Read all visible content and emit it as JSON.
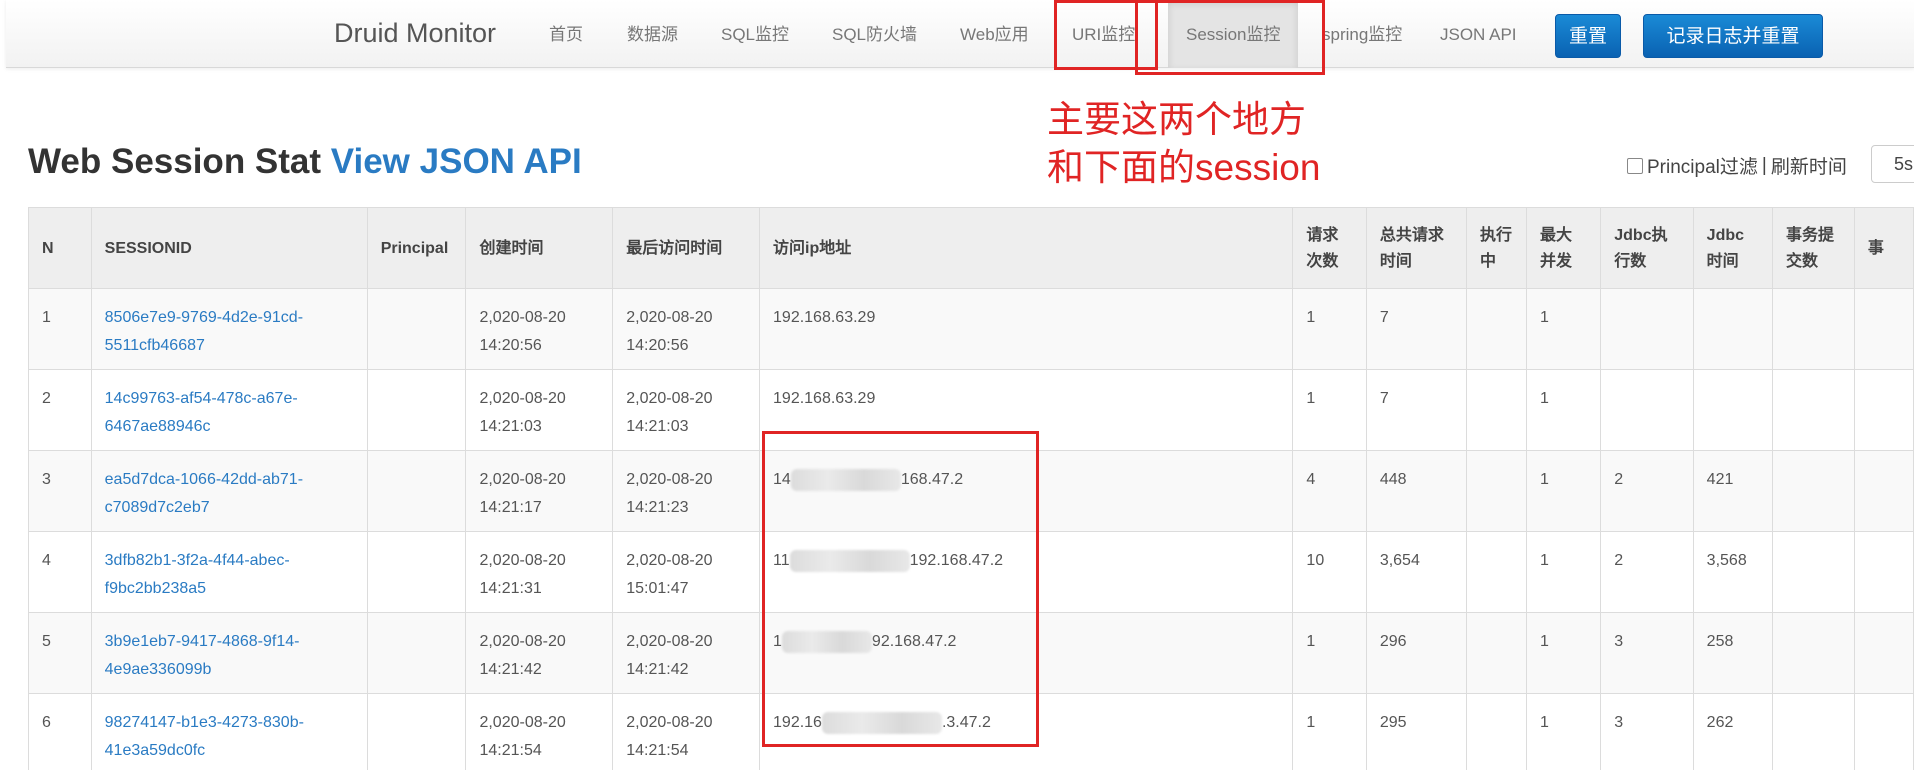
{
  "navbar": {
    "brand": "Druid Monitor",
    "items": [
      "首页",
      "数据源",
      "SQL监控",
      "SQL防火墙",
      "Web应用",
      "URI监控",
      "Session监控",
      "spring监控",
      "JSON API"
    ],
    "active_item": "Session监控",
    "reset_button": "重置",
    "log_reset_button": "记录日志并重置",
    "button_color": "#0e6fc0"
  },
  "page": {
    "title": "Web Session Stat",
    "title_link": "View JSON API",
    "principal_filter_label": "Principal过滤",
    "separator": "|",
    "refresh_label": "刷新时间",
    "refresh_value": "5s"
  },
  "table": {
    "headers": [
      "N",
      "SESSIONID",
      "Principal",
      "创建时间",
      "最后访问时间",
      "访问ip地址",
      "请求次数",
      "总共请求时间",
      "执行中",
      "最大并发",
      "Jdbc执行数",
      "Jdbc时间",
      "事务提交数",
      "事"
    ],
    "rows": [
      {
        "n": "1",
        "session_id": [
          "8506e7e9-9769-4d2e-91cd-",
          "5511cfb46687"
        ],
        "principal": "",
        "created": [
          "2,020-08-20",
          "14:20:56"
        ],
        "last_access": [
          "2,020-08-20",
          "14:20:56"
        ],
        "ip_prefix": "192.168.63.29",
        "ip_suffix": "",
        "requests": "1",
        "total_time": "7",
        "running": "",
        "max_concurrent": "1",
        "jdbc_exec": "",
        "jdbc_time": "",
        "tx_commit": ""
      },
      {
        "n": "2",
        "session_id": [
          "14c99763-af54-478c-a67e-",
          "6467ae88946c"
        ],
        "principal": "",
        "created": [
          "2,020-08-20",
          "14:21:03"
        ],
        "last_access": [
          "2,020-08-20",
          "14:21:03"
        ],
        "ip_prefix": "192.168.63.29",
        "ip_suffix": "",
        "requests": "1",
        "total_time": "7",
        "running": "",
        "max_concurrent": "1",
        "jdbc_exec": "",
        "jdbc_time": "",
        "tx_commit": ""
      },
      {
        "n": "3",
        "session_id": [
          "ea5d7dca-1066-42dd-ab71-",
          "c7089d7c2eb7"
        ],
        "principal": "",
        "created": [
          "2,020-08-20",
          "14:21:17"
        ],
        "last_access": [
          "2,020-08-20",
          "14:21:23"
        ],
        "ip_prefix": "14",
        "ip_suffix": "168.47.2",
        "requests": "4",
        "total_time": "448",
        "running": "",
        "max_concurrent": "1",
        "jdbc_exec": "2",
        "jdbc_time": "421",
        "tx_commit": ""
      },
      {
        "n": "4",
        "session_id": [
          "3dfb82b1-3f2a-4f44-abec-",
          "f9bc2bb238a5"
        ],
        "principal": "",
        "created": [
          "2,020-08-20",
          "14:21:31"
        ],
        "last_access": [
          "2,020-08-20",
          "15:01:47"
        ],
        "ip_prefix": "11",
        "ip_suffix": "192.168.47.2",
        "requests": "10",
        "total_time": "3,654",
        "running": "",
        "max_concurrent": "1",
        "jdbc_exec": "2",
        "jdbc_time": "3,568",
        "tx_commit": ""
      },
      {
        "n": "5",
        "session_id": [
          "3b9e1eb7-9417-4868-9f14-",
          "4e9ae336099b"
        ],
        "principal": "",
        "created": [
          "2,020-08-20",
          "14:21:42"
        ],
        "last_access": [
          "2,020-08-20",
          "14:21:42"
        ],
        "ip_prefix": "1",
        "ip_suffix": "92.168.47.2",
        "requests": "1",
        "total_time": "296",
        "running": "",
        "max_concurrent": "1",
        "jdbc_exec": "3",
        "jdbc_time": "258",
        "tx_commit": ""
      },
      {
        "n": "6",
        "session_id": [
          "98274147-b1e3-4273-830b-",
          "41e3a59dc0fc"
        ],
        "principal": "",
        "created": [
          "2,020-08-20",
          "14:21:54"
        ],
        "last_access": [
          "2,020-08-20",
          "14:21:54"
        ],
        "ip_prefix": "192.16",
        "ip_suffix": ".3.47.2",
        "requests": "1",
        "total_time": "295",
        "running": "",
        "max_concurrent": "1",
        "jdbc_exec": "3",
        "jdbc_time": "262",
        "tx_commit": ""
      }
    ]
  },
  "annotation": {
    "line1": "主要这两个地方",
    "line2": "和下面的session",
    "color": "#e02424"
  }
}
